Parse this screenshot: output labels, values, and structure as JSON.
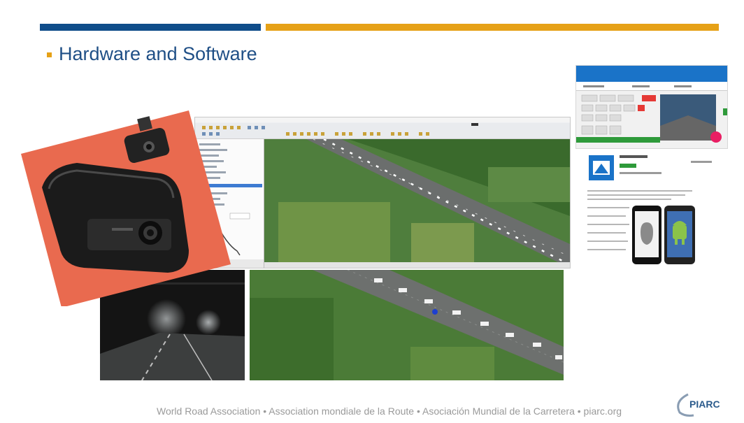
{
  "slide": {
    "title": "Hardware and Software",
    "footer": "World Road Association • Association mondiale de la Route • Asociación Mundial de la Carretera • piarc.org",
    "logo_text": "PIARC"
  },
  "colors": {
    "blue_bar": "#0f4d8a",
    "orange_bar": "#e6a117",
    "title_blue": "#1f4f86",
    "card_coral": "#e96a4f",
    "map_green": "#4b7a3a",
    "app_blue": "#1a73c8",
    "record_red": "#e53935",
    "app_button_pink": "#e91e63"
  },
  "images": {
    "dashcam": "dashcam-photo",
    "gis_window": "gis-desktop-window",
    "night_video": "dashcam-night-video-frame",
    "aerial_map": "aerial-road-map",
    "phone_app": "road-tracker-app-screenshot",
    "app_store": "road-tracker-store-listing"
  }
}
